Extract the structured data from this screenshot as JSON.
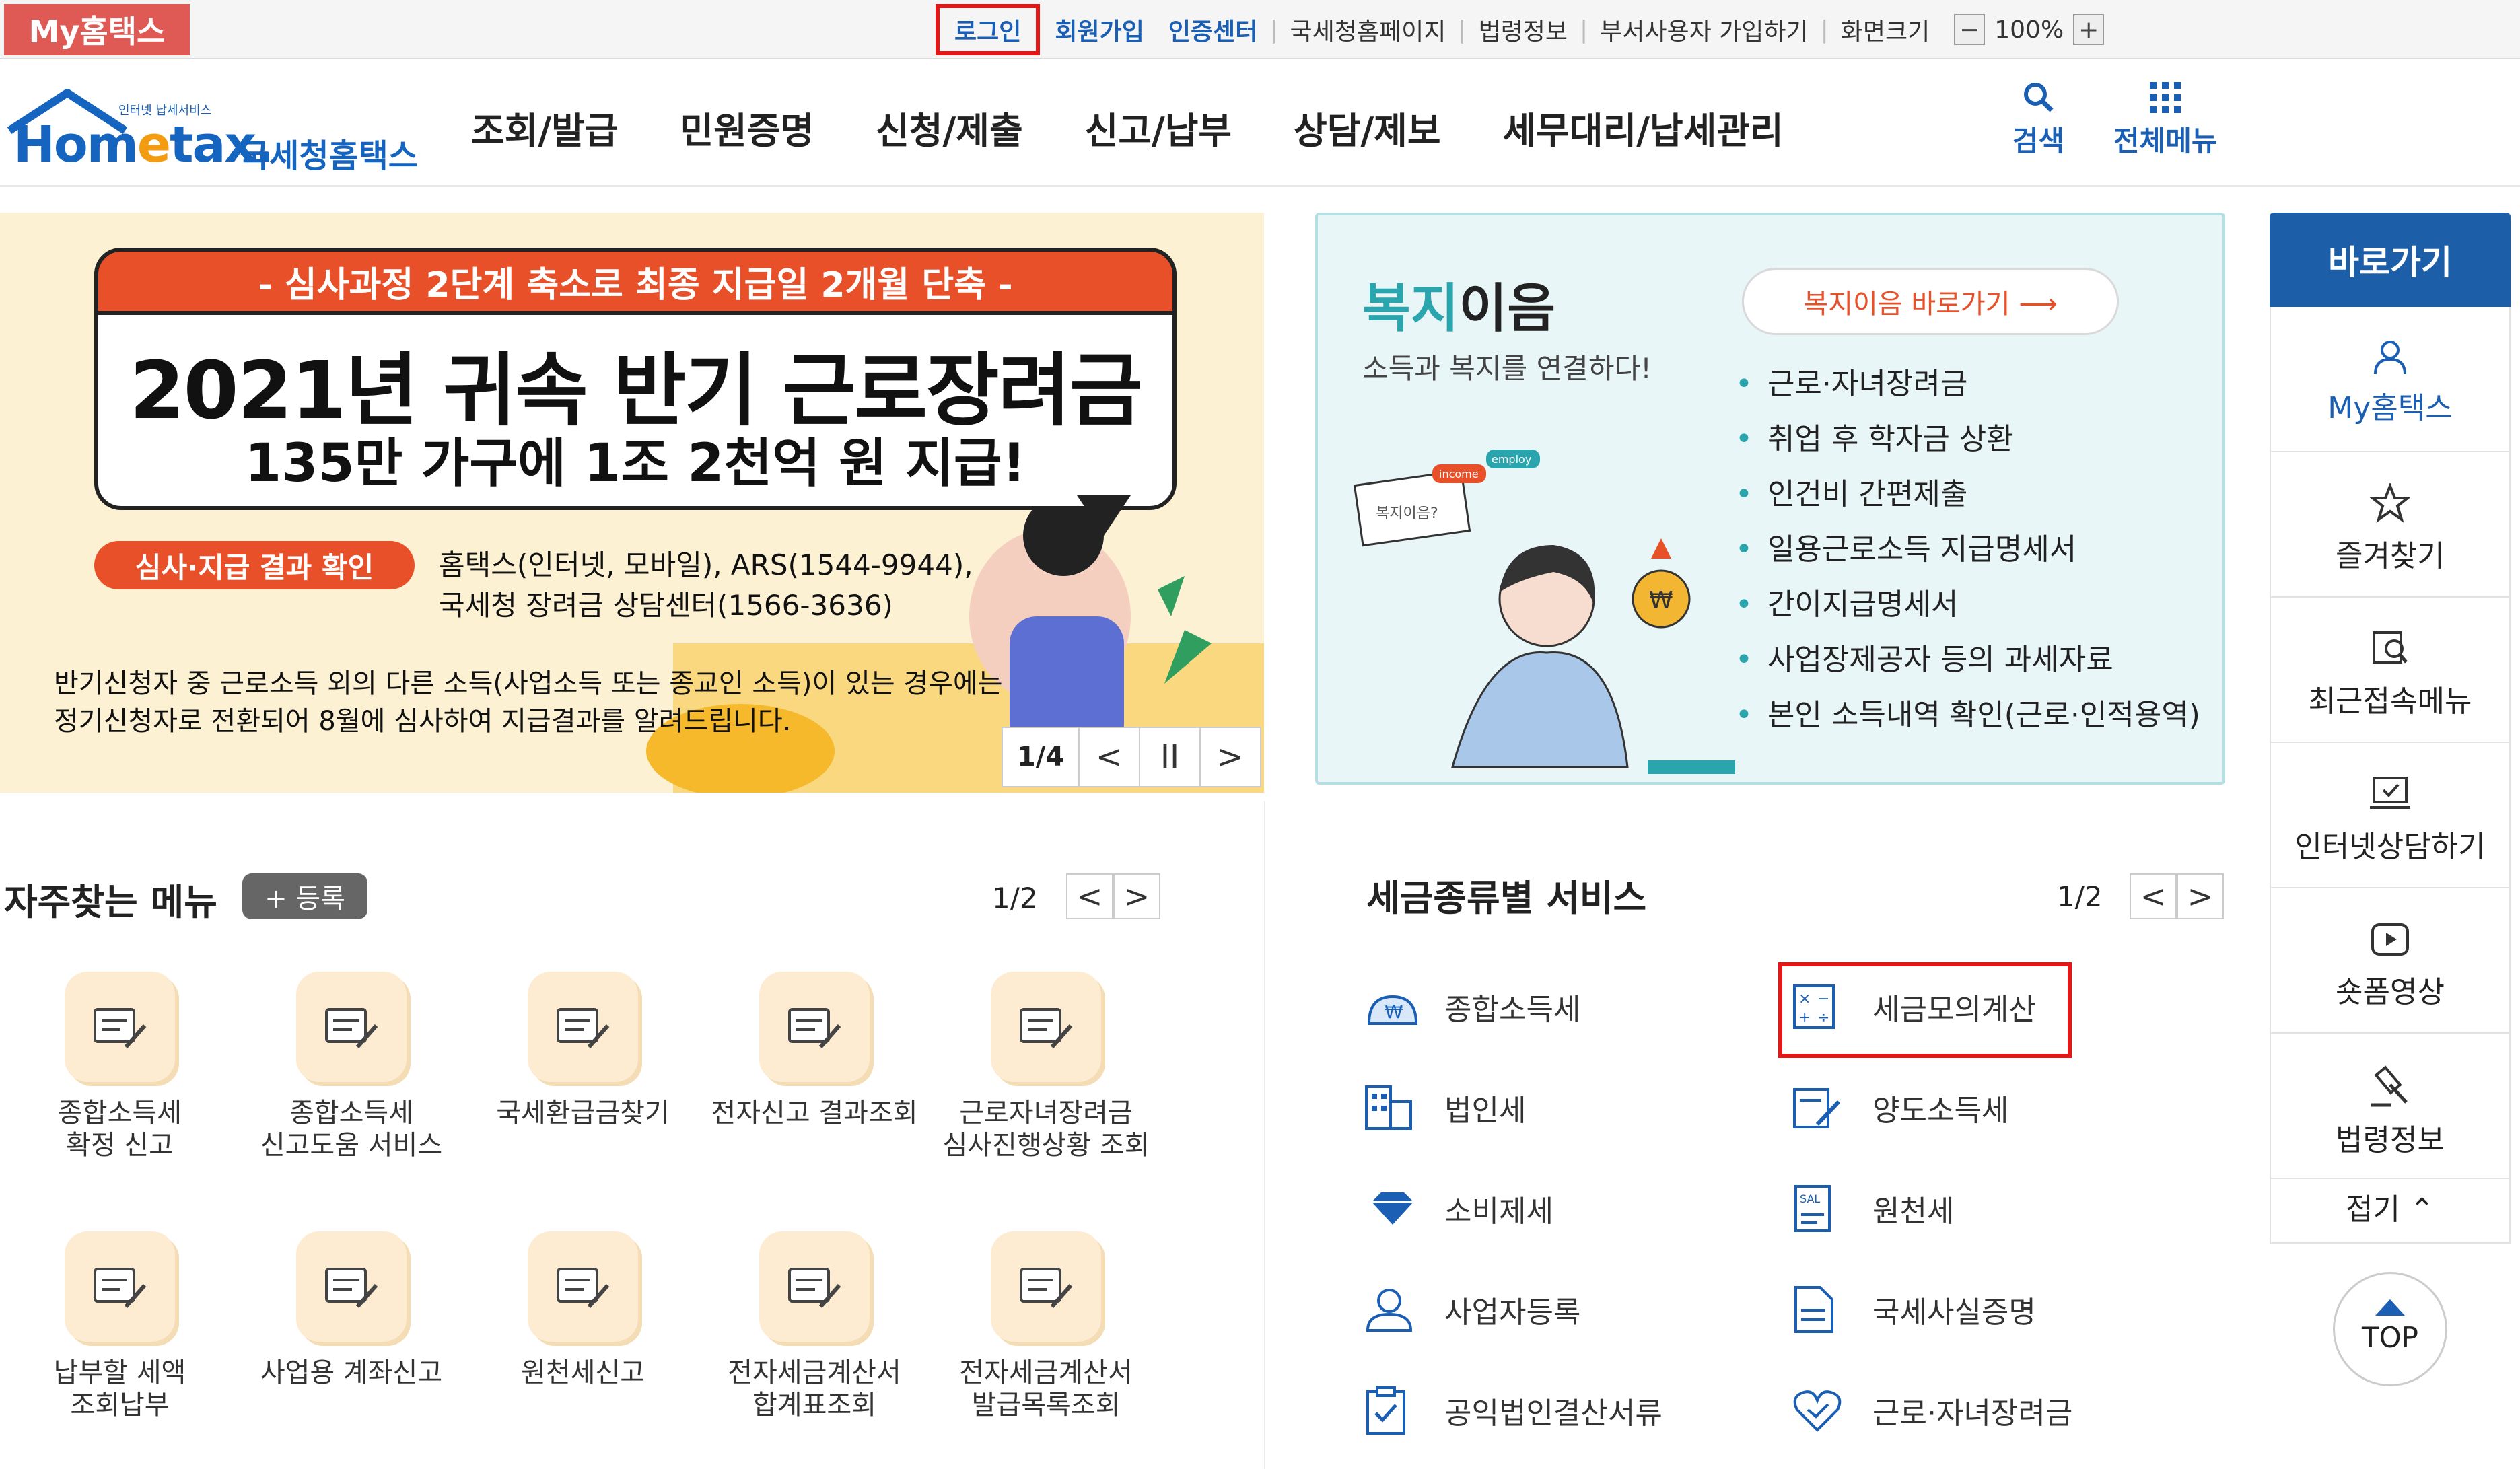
{
  "topbar": {
    "brand": "My홈택스",
    "links": [
      {
        "label": "로그인",
        "style": "login"
      },
      {
        "label": "회원가입",
        "style": "blue"
      },
      {
        "label": "인증센터",
        "style": "blue"
      },
      {
        "label": "국세청홈페이지",
        "style": "plain"
      },
      {
        "label": "법령정보",
        "style": "plain"
      },
      {
        "label": "부서사용자 가입하기",
        "style": "plain"
      },
      {
        "label": "화면크기",
        "style": "plain"
      }
    ],
    "zoom_minus": "−",
    "zoom_value": "100%",
    "zoom_plus": "+"
  },
  "header": {
    "logo_small": "인터넷 납세서비스",
    "logo_word_a": "Hom",
    "logo_word_e": "e",
    "logo_word_b": "tax.",
    "logo_ko": "국세청홈택스",
    "gnb": [
      "조회/발급",
      "민원증명",
      "신청/제출",
      "신고/납부",
      "상담/제보",
      "세무대리/납세관리"
    ],
    "search_label": "검색",
    "allmenu_label": "전체메뉴"
  },
  "banner": {
    "ribbon": "- 심사과정 2단계 축소로 최종 지급일 2개월 단축 -",
    "title": "2021년 귀속 반기 근로장려금",
    "subtitle": "135만 가구에 1조 2천억 원 지급!",
    "check_pill": "심사·지급 결과 확인",
    "contact1": "홈택스(인터넷, 모바일), ARS(1544-9944),",
    "contact2": "국세청 장려금 상담센터(1566-3636)",
    "note1": "반기신청자 중 근로소득 외의 다른 소득(사업소득 또는 종교인 소득)이 있는 경우에는",
    "note2": "정기신청자로 전환되어 8월에 심사하여 지급결과를 알려드립니다.",
    "pager": "1/4",
    "prev": "<",
    "pause": "II",
    "next": ">"
  },
  "welfare": {
    "title_accent": "복지",
    "title_rest": "이음",
    "desc": "소득과 복지를 연결하다!",
    "go_button": "복지이음 바로가기 ⟶",
    "items": [
      "근로·자녀장려금",
      "취업 후 학자금 상환",
      "인건비 간편제출",
      "일용근로소득 지급명세서",
      "간이지급명세서",
      "사업장제공자 등의 과세자료",
      "본인 소득내역 확인(근로·인적용역)"
    ],
    "illus_bubble": "복지이음?",
    "illus_tag1": "income",
    "illus_tag2": "employ"
  },
  "quicknav": {
    "head": "바로가기",
    "items": [
      {
        "label": "My홈택스",
        "icon": "user-icon"
      },
      {
        "label": "즐겨찾기",
        "icon": "star-icon"
      },
      {
        "label": "최근접속메뉴",
        "icon": "recent-menu-icon"
      },
      {
        "label": "인터넷상담하기",
        "icon": "monitor-chat-icon"
      },
      {
        "label": "숏폼영상",
        "icon": "play-icon"
      },
      {
        "label": "법령정보",
        "icon": "gavel-icon"
      }
    ],
    "fold": "접기 ⌃",
    "top": "TOP"
  },
  "frequent": {
    "title": "자주찾는 메뉴",
    "register": "+ 등록",
    "page": "1/2",
    "prev": "<",
    "next": ">",
    "items": [
      "종합소득세\n확정 신고",
      "종합소득세\n신고도움 서비스",
      "국세환급금찾기",
      "전자신고 결과조회",
      "근로자녀장려금\n심사진행상황 조회",
      "납부할 세액\n조회납부",
      "사업용 계좌신고",
      "원천세신고",
      "전자세금계산서\n합계표조회",
      "전자세금계산서\n발급목록조회"
    ]
  },
  "tax": {
    "title": "세금종류별 서비스",
    "page": "1/2",
    "prev": "<",
    "next": ">",
    "items": [
      {
        "label": "종합소득세",
        "icon": "won-bag-icon"
      },
      {
        "label": "세금모의계산",
        "icon": "calculator-icon"
      },
      {
        "label": "법인세",
        "icon": "building-icon"
      },
      {
        "label": "양도소득세",
        "icon": "document-sign-icon"
      },
      {
        "label": "소비제세",
        "icon": "diamond-icon"
      },
      {
        "label": "원천세",
        "icon": "salary-doc-icon"
      },
      {
        "label": "사업자등록",
        "icon": "person-icon"
      },
      {
        "label": "국세사실증명",
        "icon": "certificate-icon"
      },
      {
        "label": "공익법인결산서류",
        "icon": "clipboard-icon"
      },
      {
        "label": "근로·자녀장려금",
        "icon": "heart-hand-icon"
      }
    ]
  },
  "colors": {
    "brand_red": "#e05a55",
    "blue": "#1a5fb4",
    "accent_orange": "#e8502a",
    "teal": "#2ba5ad",
    "highlight": "#e01818"
  }
}
